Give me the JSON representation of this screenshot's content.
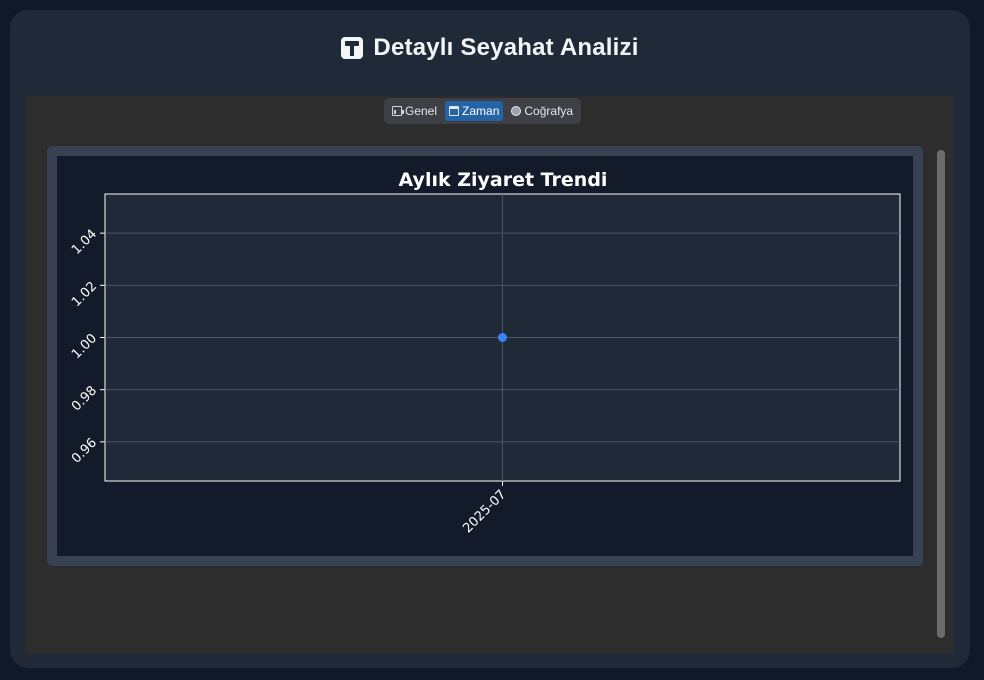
{
  "header": {
    "title": "Detaylı Seyahat Analizi",
    "icon": "dashboard-icon"
  },
  "tabs": [
    {
      "label": "Genel",
      "icon": "chart-icon",
      "active": false
    },
    {
      "label": "Zaman",
      "icon": "calendar-icon",
      "active": true
    },
    {
      "label": "Coğrafya",
      "icon": "globe-icon",
      "active": false
    }
  ],
  "colors": {
    "accent": "#2563a8",
    "point": "#3b82f6",
    "background": "#111827",
    "card": "#1f2937"
  },
  "chart_data": {
    "type": "line",
    "title": "Aylık Ziyaret Trendi",
    "xlabel": "",
    "ylabel": "",
    "x": [
      "2025-07"
    ],
    "series": [
      {
        "values": [
          1.0
        ]
      }
    ],
    "ylim": [
      0.945,
      1.055
    ],
    "yticks": [
      0.96,
      0.98,
      1.0,
      1.02,
      1.04
    ],
    "ytick_labels": [
      "0.96",
      "0.98",
      "1.00",
      "1.02",
      "1.04"
    ],
    "grid": true
  }
}
